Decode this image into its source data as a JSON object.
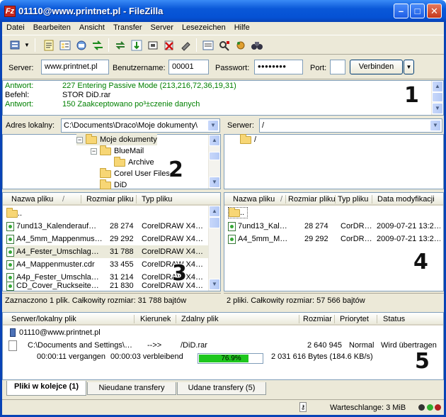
{
  "window": {
    "title": "01110@www.printnet.pl - FileZilla",
    "app_icon": "Fz"
  },
  "menu": [
    "Datei",
    "Bearbeiten",
    "Ansicht",
    "Transfer",
    "Server",
    "Lesezeichen",
    "Hilfe"
  ],
  "toolbar_icons": [
    "site-manager-icon",
    "dropdown-arrow-icon",
    "message-log-icon",
    "local-tree-icon",
    "remote-tree-icon",
    "transfer-queue-icon",
    "refresh-icon",
    "process-queue-icon",
    "cancel-icon",
    "disconnect-icon",
    "reconnect-icon",
    "filter-icon",
    "compare-icon",
    "sync-browse-icon",
    "search-icon"
  ],
  "quickconnect": {
    "server_label": "Server:",
    "server_value": "www.printnet.pl",
    "user_label": "Benutzername:",
    "user_value": "00001",
    "pass_label": "Passwort:",
    "pass_value": "••••••••",
    "port_label": "Port:",
    "port_value": "",
    "connect_label": "Verbinden"
  },
  "log": [
    {
      "key": "Antwort:",
      "value": "227 Entering Passive Mode (213,216,72,36,19,31)",
      "color": "#008000"
    },
    {
      "key": "Befehl:",
      "value": "STOR DiD.rar",
      "color": "#000000"
    },
    {
      "key": "Antwort:",
      "value": "150 Zaakceptowano po³±czenie danych",
      "color": "#008000"
    }
  ],
  "local": {
    "addr_label": "Adres lokalny:",
    "addr_value": "C:\\Documents\\Draco\\Moje dokumenty\\",
    "tree": [
      {
        "label": "Moje dokumenty",
        "expander": "−"
      },
      {
        "label": "BlueMail",
        "expander": "−"
      },
      {
        "label": "Archive",
        "expander": ""
      },
      {
        "label": "Corel User Files",
        "expander": ""
      },
      {
        "label": "DiD",
        "expander": ""
      }
    ],
    "headers": [
      "Nazwa pliku",
      "/",
      "Rozmiar pliku",
      "Typ pliku"
    ],
    "files": [
      {
        "name": "..",
        "size": "",
        "type": ""
      },
      {
        "name": "7und13_Kalenderauf…",
        "size": "28 274",
        "type": "CorelDRAW X4…"
      },
      {
        "name": "A4_5mm_Mappenmus…",
        "size": "29 292",
        "type": "CorelDRAW X4…"
      },
      {
        "name": "A4_Fester_Umschlag…",
        "size": "31 788",
        "type": "CorelDRAW X4…"
      },
      {
        "name": "A4_Mappenmuster.cdr",
        "size": "33 455",
        "type": "CorelDRAW X4…"
      },
      {
        "name": "A4p_Fester_Umschla…",
        "size": "31 214",
        "type": "CorelDRAW X4…"
      },
      {
        "name": "CD_Cover_Ruckseite…",
        "size": "21 830",
        "type": "CorelDRAW X4…"
      }
    ],
    "status": "Zaznaczono 1 plik. Całkowity rozmiar: 31 788 bajtów"
  },
  "remote": {
    "addr_label": "Serwer:",
    "addr_value": "/",
    "tree": [
      {
        "label": "/"
      }
    ],
    "headers": [
      "Nazwa pliku",
      "/",
      "Rozmiar pliku",
      "Typ pliku",
      "Data modyfikacji"
    ],
    "files": [
      {
        "name": "..",
        "size": "",
        "type": "",
        "date": ""
      },
      {
        "name": "7und13_Kal…",
        "size": "28 274",
        "type": "CorDR…",
        "date": "2009-07-21 13:2…"
      },
      {
        "name": "A4_5mm_M…",
        "size": "29 292",
        "type": "CorDR…",
        "date": "2009-07-21 13:2…"
      }
    ],
    "status": "2 pliki. Całkowity rozmiar: 57 566 bajtów"
  },
  "queue": {
    "headers": [
      "Serwer/lokalny plik",
      "Kierunek",
      "Zdalny plik",
      "Rozmiar",
      "Priorytet",
      "Status"
    ],
    "server": "01110@www.printnet.pl",
    "local_file": "C:\\Documents and Settings\\…",
    "direction": "-->>",
    "remote_file": "/DiD.rar",
    "size": "2 640 945",
    "priority": "Normal",
    "status": "Wird übertragen",
    "elapsed": "00:00:11 vergangen",
    "remaining": "00:00:03 verbleibend",
    "progress_percent": 76.9,
    "progress_label": "76.9%",
    "bytes": "2 031 616 Bytes (184.6 KB/s)"
  },
  "tabs": [
    {
      "label": "Pliki w kolejce (1)",
      "active": true
    },
    {
      "label": "Nieudane transfery",
      "active": false
    },
    {
      "label": "Udane transfery (5)",
      "active": false
    }
  ],
  "statusbar": {
    "queue": "Warteschlange: 3 MiB"
  },
  "annotations": [
    "1",
    "2",
    "3",
    "4",
    "5"
  ],
  "colors": {
    "title_blue": "#0a58d8",
    "log_green": "#008000",
    "progress_green": "#1ec71e"
  }
}
